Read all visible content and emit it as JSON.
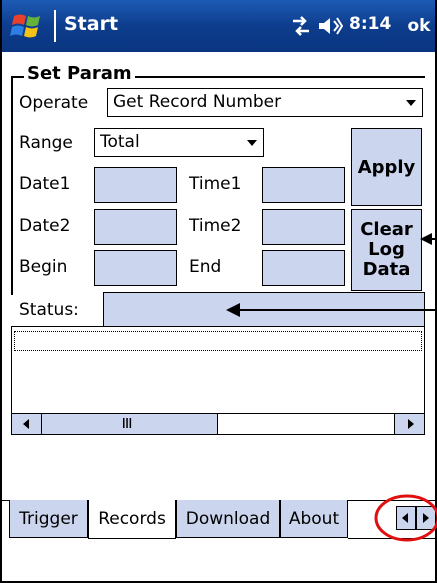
{
  "titlebar": {
    "title": "Start",
    "time": "8:14",
    "ok_label": "ok",
    "icons": [
      "windows-flag-icon",
      "connectivity-icon",
      "speaker-icon"
    ],
    "color": "#0d3d8d"
  },
  "group": {
    "title": "Set Param",
    "operate_label": "Operate",
    "operate_value": "Get Record Number",
    "range_label": "Range",
    "range_value": "Total",
    "date1_label": "Date1",
    "time1_label": "Time1",
    "date2_label": "Date2",
    "time2_label": "Time2",
    "begin_label": "Begin",
    "end_label": "End",
    "apply_label": "Apply",
    "clear_label_1": "Clear",
    "clear_label_2": "Log",
    "clear_label_3": "Data"
  },
  "status": {
    "label": "Status:",
    "value": ""
  },
  "tabs": [
    {
      "label": "Trigger",
      "active": false
    },
    {
      "label": "Records",
      "active": true
    },
    {
      "label": "Download",
      "active": false
    },
    {
      "label": "About",
      "active": false
    }
  ],
  "colors": {
    "field_fill": "#cbd6ee",
    "annotation_arrow": "#000000",
    "annotation_circle": "#e01010"
  }
}
